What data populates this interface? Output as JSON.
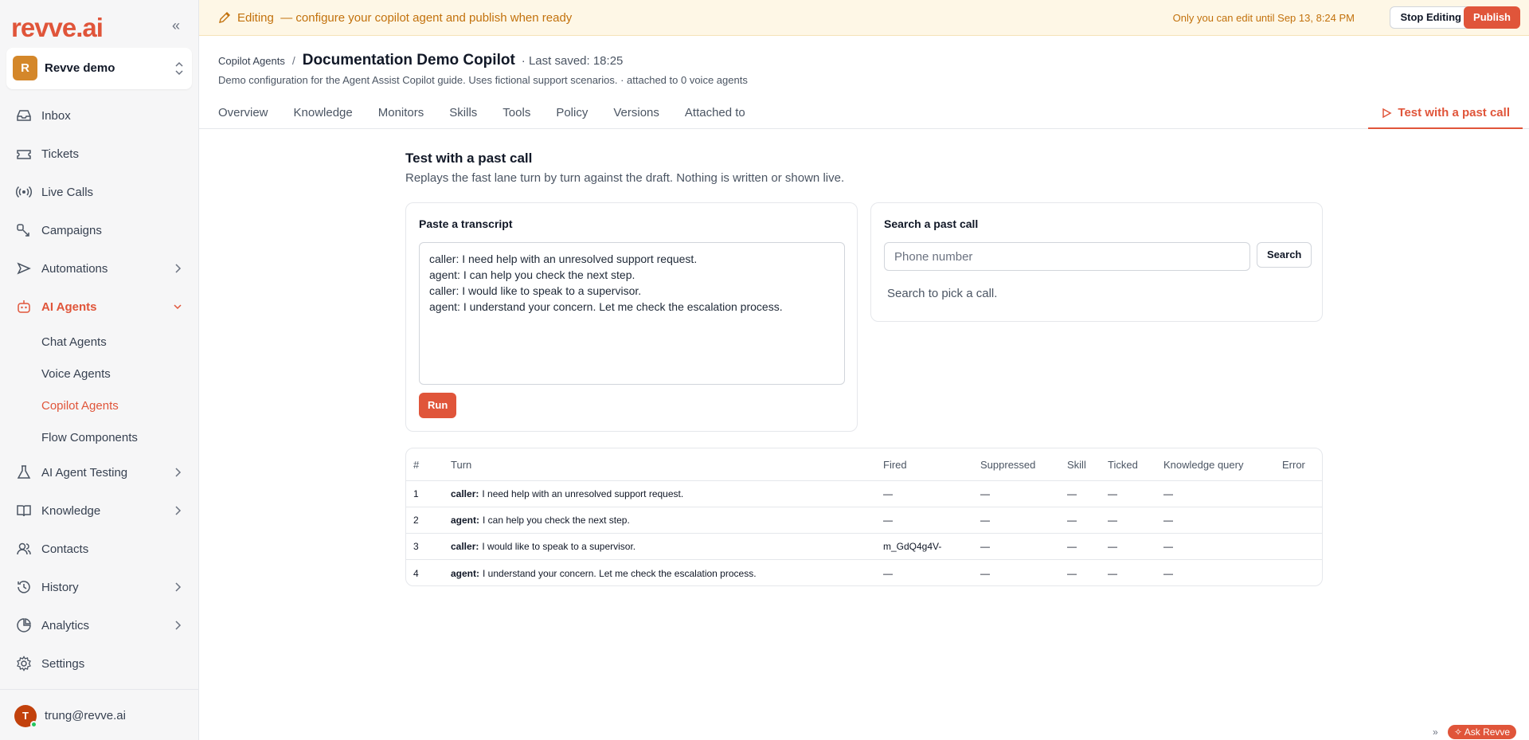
{
  "brand": {
    "logo_text": "revve.ai",
    "accent": "#e0553a"
  },
  "workspace": {
    "initial": "R",
    "name": "Revve demo"
  },
  "sidebar": {
    "items": [
      {
        "label": "Inbox",
        "icon": "inbox-icon"
      },
      {
        "label": "Tickets",
        "icon": "ticket-icon"
      },
      {
        "label": "Live Calls",
        "icon": "broadcast-icon"
      },
      {
        "label": "Campaigns",
        "icon": "campaign-icon"
      },
      {
        "label": "Automations",
        "icon": "automation-icon"
      },
      {
        "label": "AI Agents",
        "icon": "robot-icon"
      },
      {
        "label": "AI Agent Testing",
        "icon": "flask-icon"
      },
      {
        "label": "Knowledge",
        "icon": "book-icon"
      },
      {
        "label": "Contacts",
        "icon": "contacts-icon"
      },
      {
        "label": "History",
        "icon": "history-icon"
      },
      {
        "label": "Analytics",
        "icon": "analytics-icon"
      },
      {
        "label": "Settings",
        "icon": "gear-icon"
      }
    ],
    "sub_items": [
      "Chat Agents",
      "Voice Agents",
      "Copilot Agents",
      "Flow Components"
    ]
  },
  "user": {
    "initial": "T",
    "email": "trung@revve.ai"
  },
  "banner": {
    "editing": "Editing",
    "message": "— configure your copilot agent and publish when ready",
    "lock_text": "Only you can edit until Sep 13, 8:24 PM",
    "stop_label": "Stop Editing",
    "publish_label": "Publish"
  },
  "header": {
    "breadcrumb": "Copilot Agents",
    "separator": "/",
    "title": "Documentation Demo Copilot",
    "last_saved": "· Last saved: 18:25",
    "description": "Demo configuration for the Agent Assist Copilot guide. Uses fictional support scenarios. · attached to 0 voice agents",
    "tabs": [
      "Overview",
      "Knowledge",
      "Monitors",
      "Skills",
      "Tools",
      "Policy",
      "Versions",
      "Attached to"
    ],
    "active_tab": "Test with a past call"
  },
  "main": {
    "title": "Test with a past call",
    "subtitle": "Replays the fast lane turn by turn against the draft. Nothing is written or shown live.",
    "paste": {
      "title": "Paste a transcript",
      "transcript": "caller: I need help with an unresolved support request.\nagent: I can help you check the next step.\ncaller: I would like to speak to a supervisor.\nagent: I understand your concern. Let me check the escalation process.",
      "run_label": "Run"
    },
    "search": {
      "title": "Search a past call",
      "placeholder": "Phone number",
      "button_label": "Search",
      "hint": "Search to pick a call."
    }
  },
  "table": {
    "columns": [
      "#",
      "Turn",
      "Fired",
      "Suppressed",
      "Skill",
      "Ticked",
      "Knowledge query",
      "Error"
    ],
    "rows": [
      {
        "num": "1",
        "speaker": "caller:",
        "text": "I need help with an unresolved support request.",
        "fired": "—",
        "suppressed": "—",
        "skill": "—",
        "ticked": "—",
        "knowledge": "—",
        "error": ""
      },
      {
        "num": "2",
        "speaker": "agent:",
        "text": "I can help you check the next step.",
        "fired": "—",
        "suppressed": "—",
        "skill": "—",
        "ticked": "—",
        "knowledge": "—",
        "error": ""
      },
      {
        "num": "3",
        "speaker": "caller:",
        "text": "I would like to speak to a supervisor.",
        "fired": "m_GdQ4g4V-",
        "suppressed": "—",
        "skill": "—",
        "ticked": "—",
        "knowledge": "—",
        "error": ""
      },
      {
        "num": "4",
        "speaker": "agent:",
        "text": "I understand your concern. Let me check the escalation process.",
        "fired": "—",
        "suppressed": "—",
        "skill": "—",
        "ticked": "—",
        "knowledge": "—",
        "error": ""
      }
    ]
  },
  "footer": {
    "ask_label": "Ask Revve"
  }
}
